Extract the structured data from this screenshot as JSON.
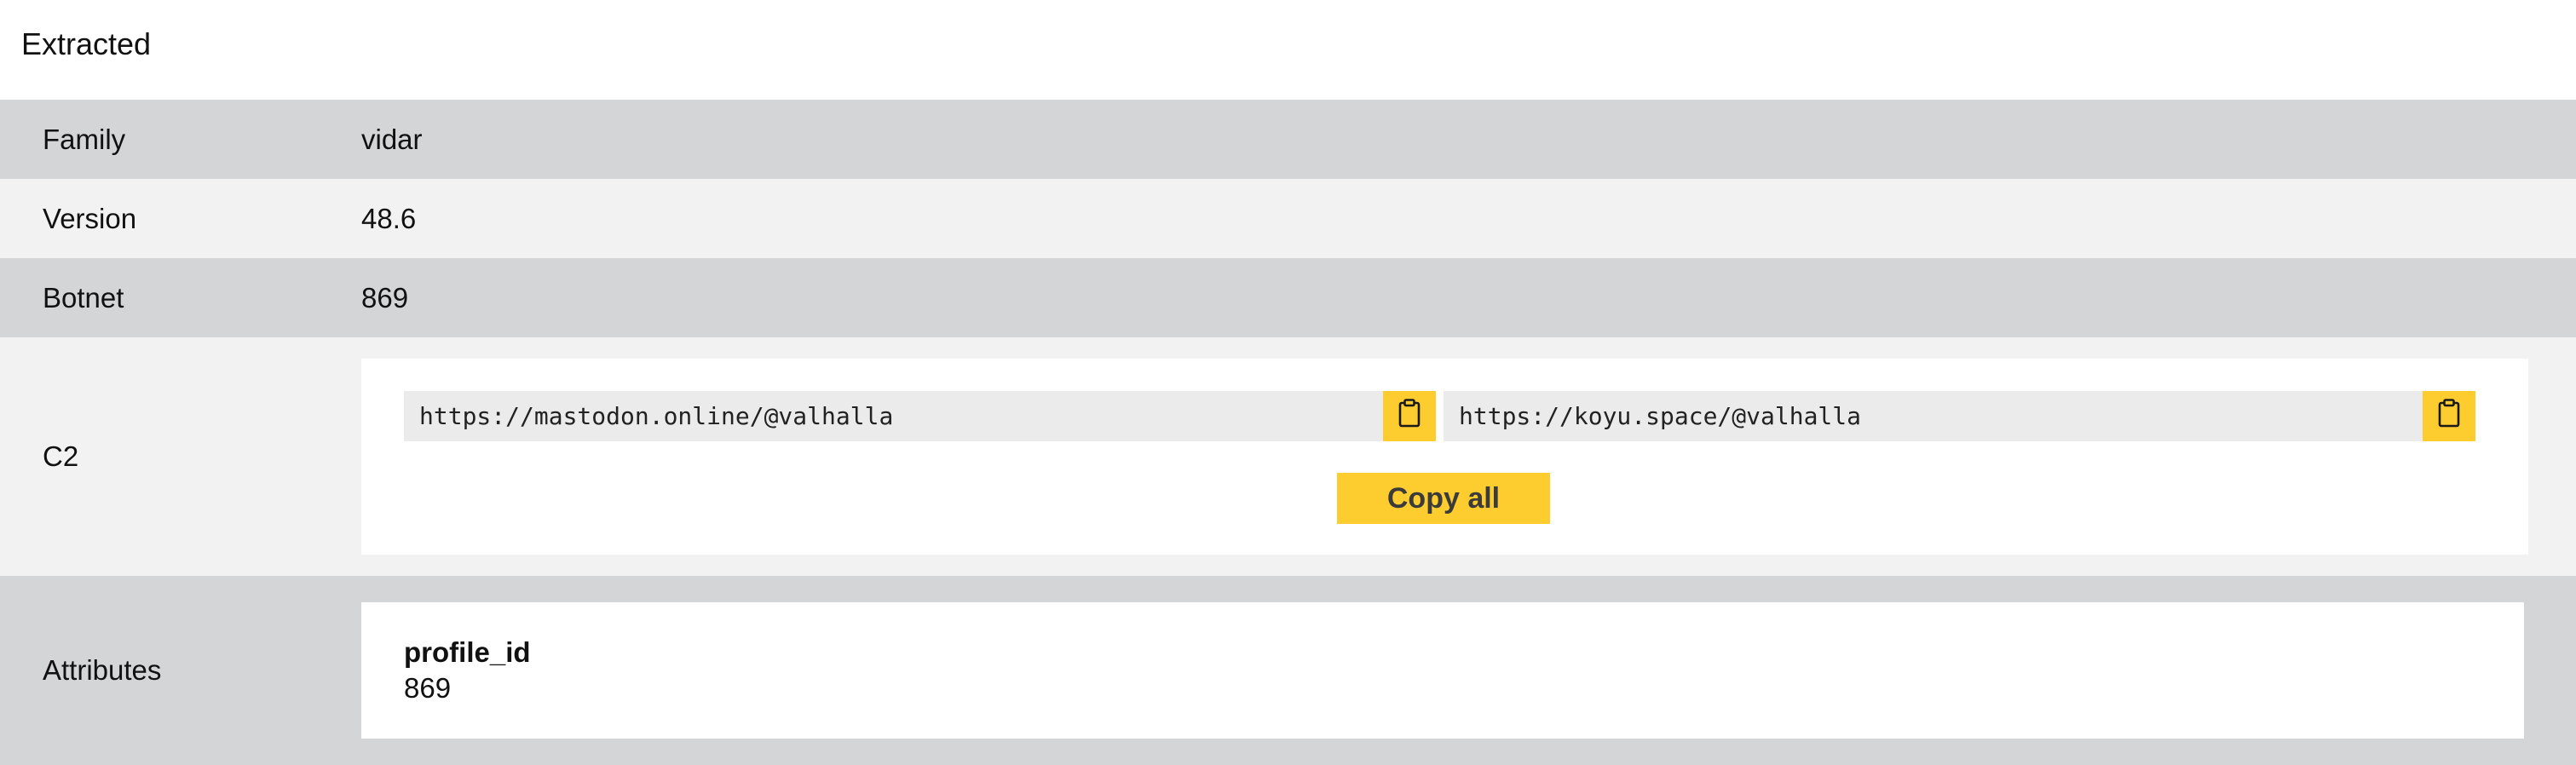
{
  "section_title": "Extracted",
  "fields": {
    "family": {
      "label": "Family",
      "value": "vidar"
    },
    "version": {
      "label": "Version",
      "value": "48.6"
    },
    "botnet": {
      "label": "Botnet",
      "value": "869"
    }
  },
  "c2": {
    "label": "C2",
    "urls": [
      "https://mastodon.online/@valhalla",
      "https://koyu.space/@valhalla"
    ],
    "copy_icon": "clipboard-icon",
    "copy_all_label": "Copy all"
  },
  "attributes": {
    "label": "Attributes",
    "items": [
      {
        "key": "profile_id",
        "value": "869"
      }
    ]
  },
  "colors": {
    "row_dark": "#d4d5d7",
    "row_light": "#f2f2f2",
    "accent_yellow": "#fdcd2f",
    "url_bg": "#ebebec"
  }
}
